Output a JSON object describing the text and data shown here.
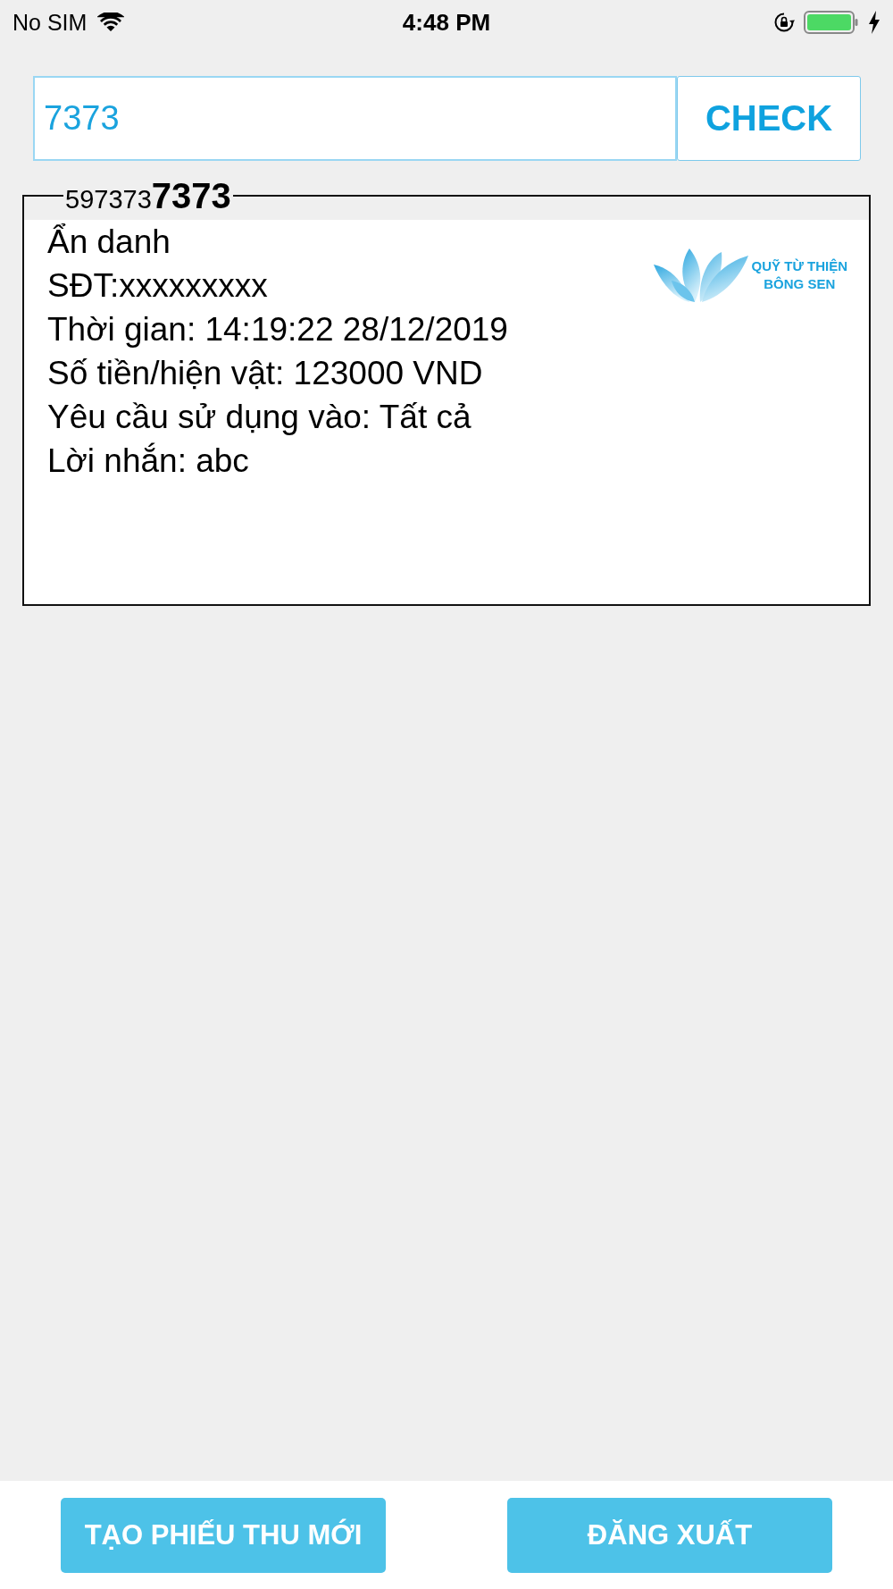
{
  "status_bar": {
    "carrier": "No SIM",
    "time": "4:48 PM"
  },
  "search": {
    "value": "7373",
    "button": "CHECK"
  },
  "record": {
    "code": "597373**7373**",
    "lines": [
      "Ẩn danh",
      "SĐT:xxxxxxxxx",
      "Thời gian: 14:19:22 28/12/2019",
      "Số tiền/hiện vật: 123000 VND",
      "Yêu cầu sử dụng vào: Tất cả",
      "Lời nhắn: abc"
    ],
    "logo_lines": [
      "QUỸ TỪ THIỆN",
      "BÔNG SEN"
    ]
  },
  "buttons": [
    "TẠO PHIẾU THU MỚI",
    "ĐĂNG XUẤT"
  ]
}
